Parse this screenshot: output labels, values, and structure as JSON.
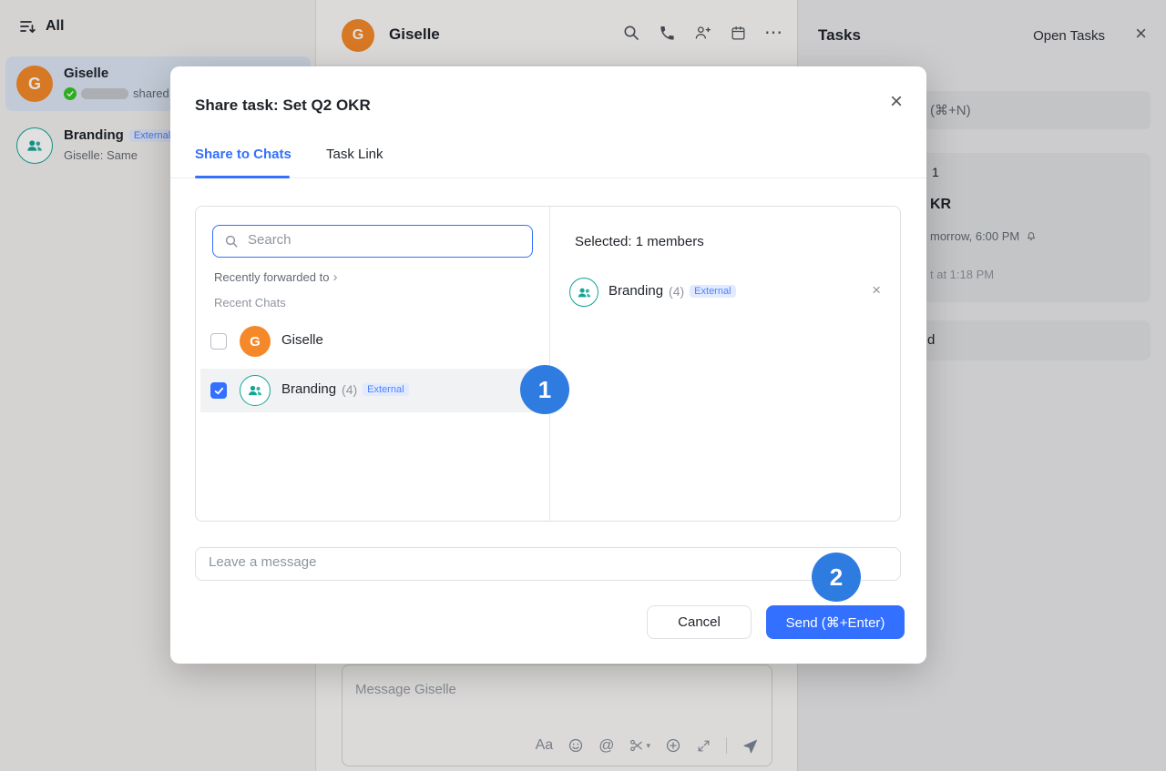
{
  "colors": {
    "accent": "#3370ff",
    "annotation_blue": "#2e7ce0",
    "avatar_orange": "#f5892a",
    "avatar_teal": "#12a594",
    "external_badge_bg": "#e1eaff",
    "external_badge_text": "#4e83fd",
    "check_green": "#34c724"
  },
  "sidebar": {
    "title": "All",
    "chats": [
      {
        "name": "Giselle",
        "avatar_letter": "G",
        "status": "shared"
      },
      {
        "name": "Branding",
        "badge": "External",
        "subtitle": "Giselle: Same"
      }
    ]
  },
  "chat_header": {
    "title": "Giselle",
    "avatar_letter": "G",
    "more_icon": "⋯"
  },
  "composer": {
    "placeholder": "Message Giselle",
    "format_label": "Aa",
    "mention_label": "@",
    "caret_icon": "▾"
  },
  "tasks_panel": {
    "title": "Tasks",
    "filter_label": "Open Tasks",
    "close_icon": "×",
    "new_task_fragment": "(⌘+N)",
    "card": {
      "frag_line1": "1",
      "frag_line2": "KR",
      "frag_line3": "morrow, 6:00 PM",
      "frag_line4": "t at 1:18 PM"
    },
    "card2_fragment": "d"
  },
  "modal": {
    "title": "Share task: Set Q2 OKR",
    "close_icon": "×",
    "tabs": [
      {
        "label": "Share to Chats"
      },
      {
        "label": "Task Link"
      }
    ],
    "search_placeholder": "Search",
    "recently_forwarded_label": "Recently forwarded to",
    "chevron_icon": "›",
    "recent_chats_label": "Recent Chats",
    "chat_options": [
      {
        "name": "Giselle",
        "avatar_letter": "G",
        "checked": false
      },
      {
        "name": "Branding",
        "count": "(4)",
        "badge": "External",
        "checked": true
      }
    ],
    "selected_header": "Selected: 1 members",
    "selected_items": [
      {
        "name": "Branding",
        "count": "(4)",
        "badge": "External",
        "remove_icon": "×"
      }
    ],
    "message_placeholder": "Leave a message",
    "cancel_label": "Cancel",
    "send_label": "Send (⌘+Enter)"
  },
  "annotations": {
    "step1": "1",
    "step2": "2"
  }
}
